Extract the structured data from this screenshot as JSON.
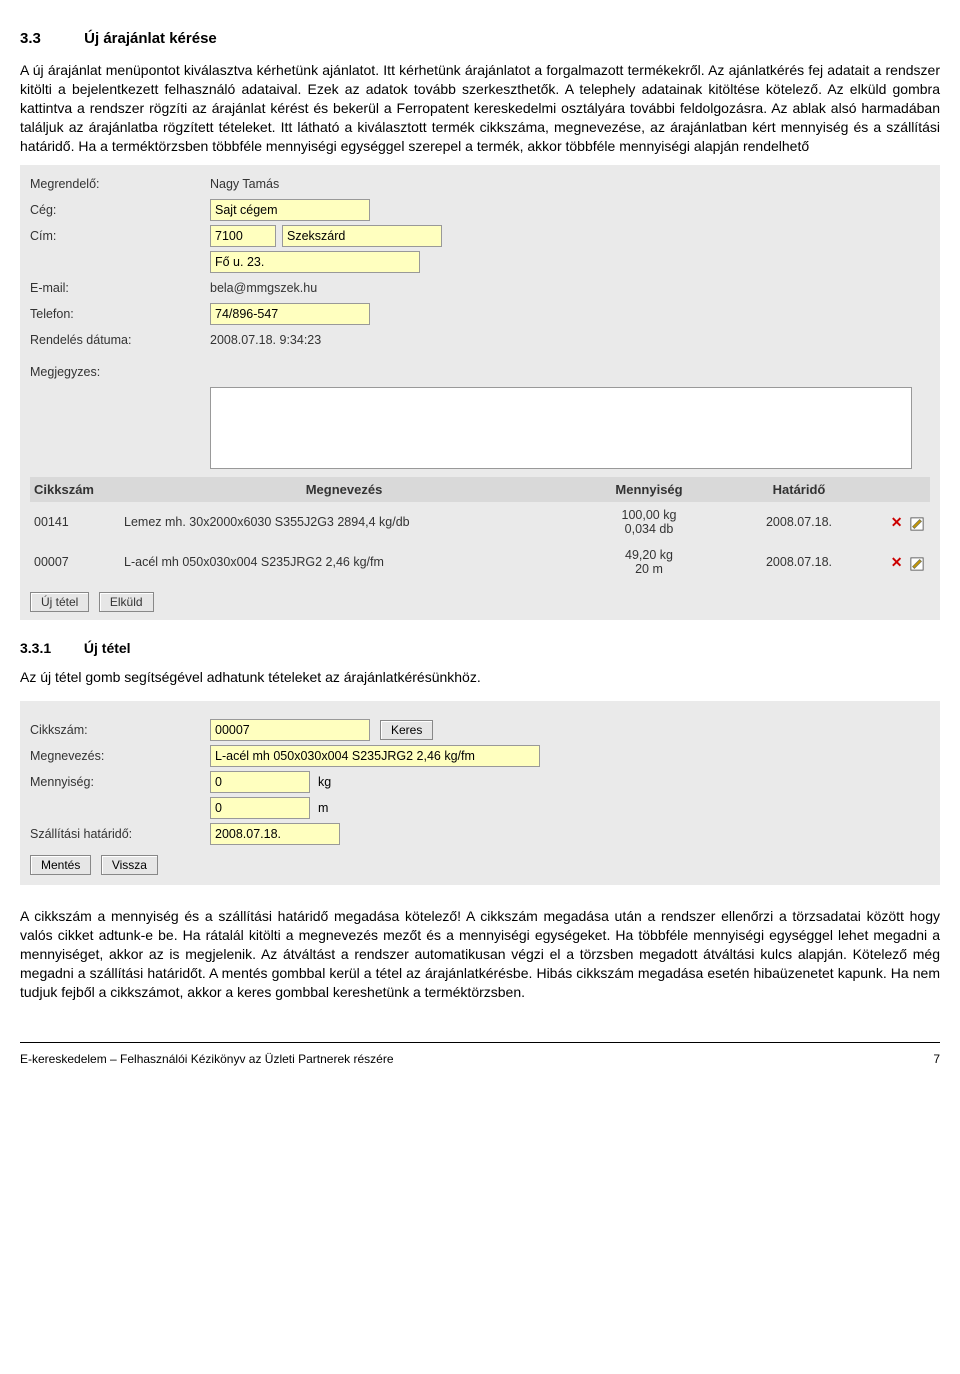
{
  "section": {
    "number": "3.3",
    "title": "Új árajánlat kérése",
    "paragraph": "A új árajánlat menüpontot kiválasztva kérhetünk ajánlatot. Itt kérhetünk árajánlatot a forgalmazott termékekről. Az ajánlatkérés fej adatait a rendszer kitölti a bejelentkezett felhasználó adataival. Ezek az adatok tovább szerkeszthetők. A telephely adatainak kitöltése kötelező. Az elküld gombra kattintva a rendszer rögzíti az árajánlat kérést és bekerül a Ferropatent kereskedelmi osztályára további feldolgozásra. Az ablak alsó harmadában találjuk az árajánlatba rögzített tételeket. Itt látható a kiválasztott termék cikkszáma, megnevezése, az árajánlatban kért mennyiség és a szállítási határidő. Ha a terméktörzsben többféle mennyiségi egységgel szerepel a termék, akkor többféle mennyiségi alapján rendelhető"
  },
  "form1": {
    "labels": {
      "megrendelo": "Megrendelő:",
      "ceg": "Cég:",
      "cim": "Cím:",
      "email": "E-mail:",
      "telefon": "Telefon:",
      "rendeles_datuma": "Rendelés dátuma:",
      "megjegyzes": "Megjegyzes:"
    },
    "values": {
      "megrendelo": "Nagy Tamás",
      "ceg": "Sajt cégem",
      "irsz": "7100",
      "varos": "Szekszárd",
      "utca": "Fő u. 23.",
      "email": "bela@mmgszek.hu",
      "telefon": "74/896-547",
      "rendeles_datuma": "2008.07.18. 9:34:23"
    },
    "table": {
      "headers": {
        "cikkszam": "Cikkszám",
        "megnevezes": "Megnevezés",
        "mennyiseg": "Mennyiség",
        "hatarido": "Határidő"
      },
      "rows": [
        {
          "cikkszam": "00141",
          "megnevezes": "Lemez mh. 30x2000x6030 S355J2G3 2894,4 kg/db",
          "meny1": "100,00 kg",
          "meny2": "0,034 db",
          "hatarido": "2008.07.18."
        },
        {
          "cikkszam": "00007",
          "megnevezes": "L-acél mh 050x030x004 S235JRG2 2,46 kg/fm",
          "meny1": "49,20 kg",
          "meny2": "20 m",
          "hatarido": "2008.07.18."
        }
      ]
    },
    "buttons": {
      "uj_tetel": "Új tétel",
      "elkuld": "Elküld"
    }
  },
  "subsection": {
    "number": "3.3.1",
    "title": "Új tétel",
    "intro": "Az új tétel gomb segítségével adhatunk tételeket az árajánlatkérésünkhöz."
  },
  "form2": {
    "labels": {
      "cikkszam": "Cikkszám:",
      "megnevezes": "Megnevezés:",
      "mennyiseg": "Mennyiség:",
      "szall_hatarido": "Szállítási határidő:"
    },
    "values": {
      "cikkszam": "00007",
      "megnevezes": "L-acél mh 050x030x004 S235JRG2 2,46 kg/fm",
      "menny1": "0",
      "egys1": "kg",
      "menny2": "0",
      "egys2": "m",
      "hatarido": "2008.07.18."
    },
    "buttons": {
      "keres": "Keres",
      "mentes": "Mentés",
      "vissza": "Vissza"
    }
  },
  "closing_para": "A cikkszám a mennyiség és a szállítási határidő megadása kötelező! A cikkszám megadása után a rendszer ellenőrzi a törzsadatai között hogy valós cikket adtunk-e be. Ha rátalál kitölti a megnevezés mezőt és a mennyiségi egységeket. Ha többféle mennyiségi egységgel lehet megadni a mennyiséget, akkor az is megjelenik. Az átváltást a rendszer automatikusan végzi el a törzsben megadott átváltási kulcs alapján. Kötelező még megadni a szállítási határidőt. A mentés gombbal kerül a tétel az árajánlatkérésbe. Hibás cikkszám megadása esetén hibaüzenetet kapunk. Ha nem tudjuk fejből a cikkszámot, akkor a keres gombbal kereshetünk a terméktörzsben.",
  "footer": {
    "left": "E-kereskedelem – Felhasználói Kézikönyv az Üzleti Partnerek részére",
    "right": "7"
  }
}
